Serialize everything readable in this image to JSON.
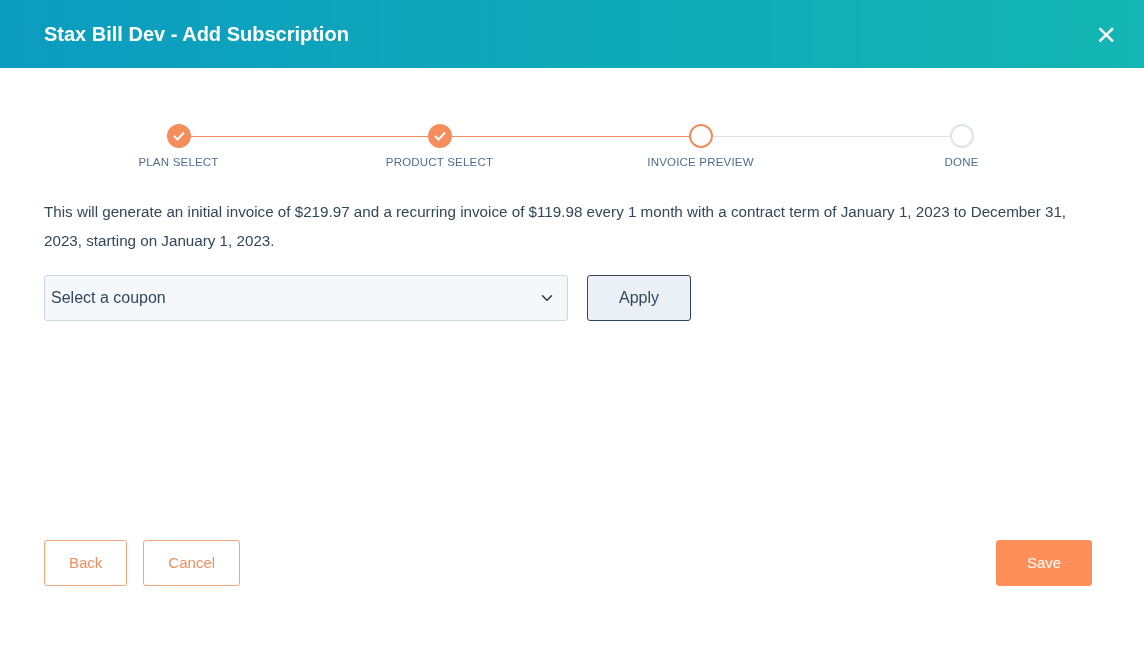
{
  "window": {
    "title": "Stax Bill Dev - Add Subscription",
    "close": "×"
  },
  "steps": [
    {
      "label": "PLAN SELECT",
      "completed": true,
      "current": false
    },
    {
      "label": "PRODUCT SELECT",
      "completed": true,
      "current": false
    },
    {
      "label": "INVOICE PREVIEW",
      "completed": false,
      "current": true
    },
    {
      "label": "DONE",
      "completed": false,
      "current": false
    }
  ],
  "summary": "This will generate an initial invoice of $219.97 and a recurring invoice of $119.98 every 1 month with a contract term of January 1, 2023 to December 31, 2023, starting on January 1, 2023.",
  "coupon": {
    "placeholder": "Select a coupon"
  },
  "apply_button": "Apply",
  "footer_buttons": [
    {
      "label": "Back",
      "kind": "outline"
    },
    {
      "label": "Cancel",
      "kind": "outline"
    },
    {
      "label": "Save",
      "kind": "primary"
    }
  ]
}
